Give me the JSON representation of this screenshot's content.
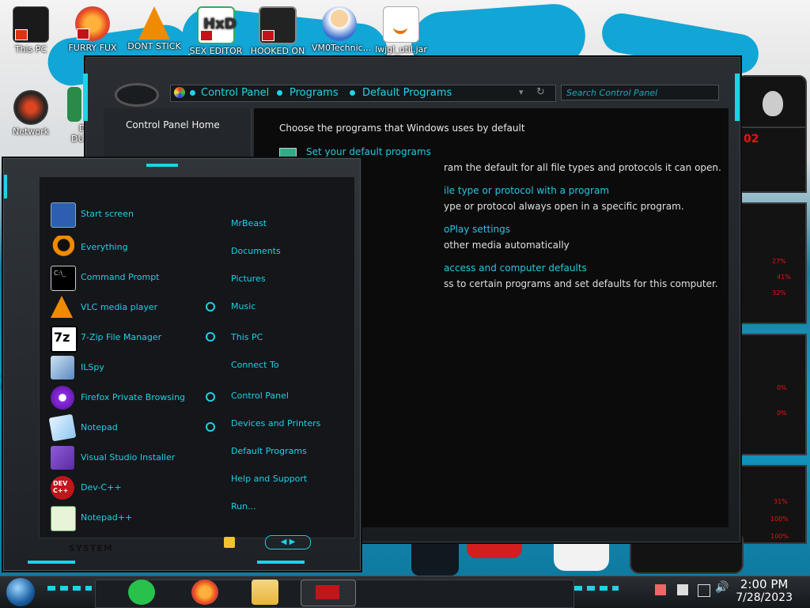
{
  "desktop": {
    "icons": [
      {
        "label": "This PC",
        "icon": "this-pc-icon"
      },
      {
        "label": "FURRY FUX",
        "icon": "firefox-icon"
      },
      {
        "label": "DONT STICK",
        "icon": "vlc-icon"
      },
      {
        "label": "SEX EDITOR",
        "icon": "hxd-icon"
      },
      {
        "label": "HOOKED ON",
        "icon": "app-icon"
      },
      {
        "label": "VM0Technic...",
        "icon": "doctor-icon"
      },
      {
        "label": "lwjgl_util.jar",
        "icon": "java-icon"
      },
      {
        "label": "Network",
        "icon": "network-icon"
      }
    ],
    "partial_labels": [
      "D",
      "DUM",
      "C",
      "H"
    ]
  },
  "control_panel": {
    "breadcrumbs": [
      "Control Panel",
      "Programs",
      "Default Programs"
    ],
    "search_placeholder": "Search Control Panel",
    "left_pane": {
      "home_link": "Control Panel Home"
    },
    "heading": "Choose the programs that Windows uses by default",
    "items": [
      {
        "link": "Set your default programs",
        "desc": "ram the default for all file types and protocols it can open."
      },
      {
        "link": "ile type or protocol with a program",
        "desc": "ype or protocol always open in a specific program."
      },
      {
        "link": "oPlay settings",
        "desc": "other media automatically"
      },
      {
        "link": "access and computer defaults",
        "desc": "ss to certain programs and set defaults for this computer."
      }
    ]
  },
  "start_menu": {
    "programs": [
      {
        "label": "Start screen",
        "icon": "start-screen-icon"
      },
      {
        "label": "Everything",
        "icon": "everything-search-icon"
      },
      {
        "label": "Command Prompt",
        "icon": "command-prompt-icon"
      },
      {
        "label": "VLC media player",
        "icon": "vlc-icon"
      },
      {
        "label": "7-Zip File Manager",
        "icon": "seven-zip-icon"
      },
      {
        "label": "ILSpy",
        "icon": "ilspy-icon"
      },
      {
        "label": "Firefox Private Browsing",
        "icon": "firefox-private-icon"
      },
      {
        "label": "Notepad",
        "icon": "notepad-icon"
      },
      {
        "label": "Visual Studio Installer",
        "icon": "visual-studio-installer-icon"
      },
      {
        "label": "Dev-C++",
        "icon": "devcpp-icon"
      },
      {
        "label": "Notepad++",
        "icon": "notepadpp-icon"
      }
    ],
    "places": [
      "MrBeast",
      "Documents",
      "Pictures",
      "Music",
      "This PC",
      "Connect To",
      "Control Panel",
      "Devices and Printers",
      "Default Programs",
      "Help and Support",
      "Run..."
    ],
    "system_label": "SYSTEM"
  },
  "taskbar": {
    "time": "2:00 PM",
    "date": "7/28/2023"
  },
  "gadgets": {
    "readouts": [
      "02",
      "27%",
      "41%",
      "32%",
      "0%",
      "0%",
      "31%",
      "100%",
      "100%"
    ]
  },
  "colors": {
    "accent": "#1fd0e6",
    "window_bg": "#0b0b0c",
    "gadget_red": "#e01010"
  }
}
